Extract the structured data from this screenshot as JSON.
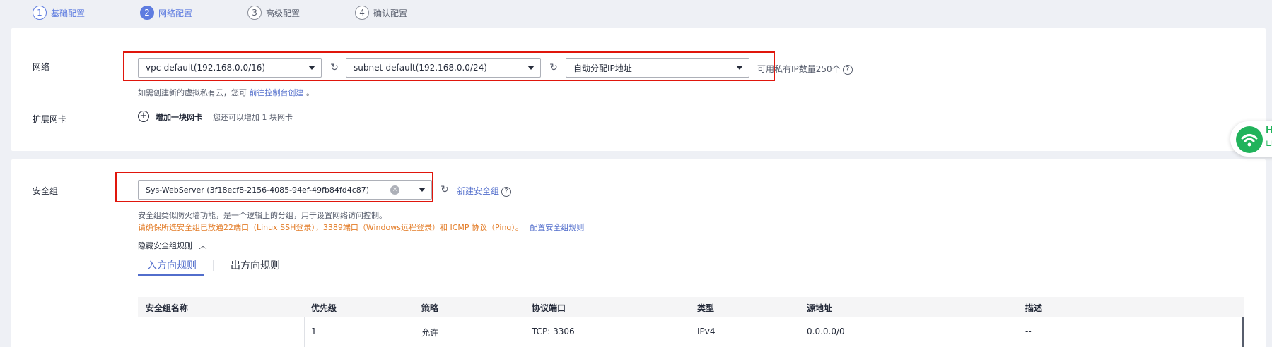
{
  "steps": [
    {
      "num": "1",
      "label": "基础配置"
    },
    {
      "num": "2",
      "label": "网络配置"
    },
    {
      "num": "3",
      "label": "高级配置"
    },
    {
      "num": "4",
      "label": "确认配置"
    }
  ],
  "network": {
    "label": "网络",
    "vpc": "vpc-default(192.168.0.0/16)",
    "subnet": "subnet-default(192.168.0.0/24)",
    "ip_mode": "自动分配IP地址",
    "available_ip": "可用私有IP数量250个",
    "hint_prefix": "如需创建新的虚拟私有云，您可",
    "hint_link": "前往控制台创建",
    "hint_suffix": "。"
  },
  "nic": {
    "label": "扩展网卡",
    "add_label": "增加一块网卡",
    "add_hint": "您还可以增加 1 块网卡"
  },
  "security": {
    "label": "安全组",
    "selected": "Sys-WebServer (3f18ecf8-2156-4085-94ef-49fb84fd4c87)",
    "new_link": "新建安全组",
    "desc": "安全组类似防火墙功能，是一个逻辑上的分组，用于设置网络访问控制。",
    "warning": "请确保所选安全组已放通22端口（Linux SSH登录），3389端口（Windows远程登录）和 ICMP 协议（Ping）。",
    "config_link": "配置安全组规则",
    "hide_rules": "隐藏安全组规则",
    "tabs": [
      "入方向规则",
      "出方向规则"
    ],
    "table": {
      "headers": [
        "安全组名称",
        "优先级",
        "策略",
        "协议端口",
        "类型",
        "源地址",
        "描述"
      ],
      "rows": [
        [
          "",
          "1",
          "允许",
          "TCP: 3306",
          "IPv4",
          "0.0.0.0/0",
          "--"
        ]
      ]
    }
  },
  "widget": {
    "text_top": "H",
    "text_bottom": "⊔"
  },
  "colors": {
    "primary": "#5e7ce0",
    "highlight_box": "#e0160c",
    "warning": "#e37d29",
    "link": "#526ecc"
  }
}
